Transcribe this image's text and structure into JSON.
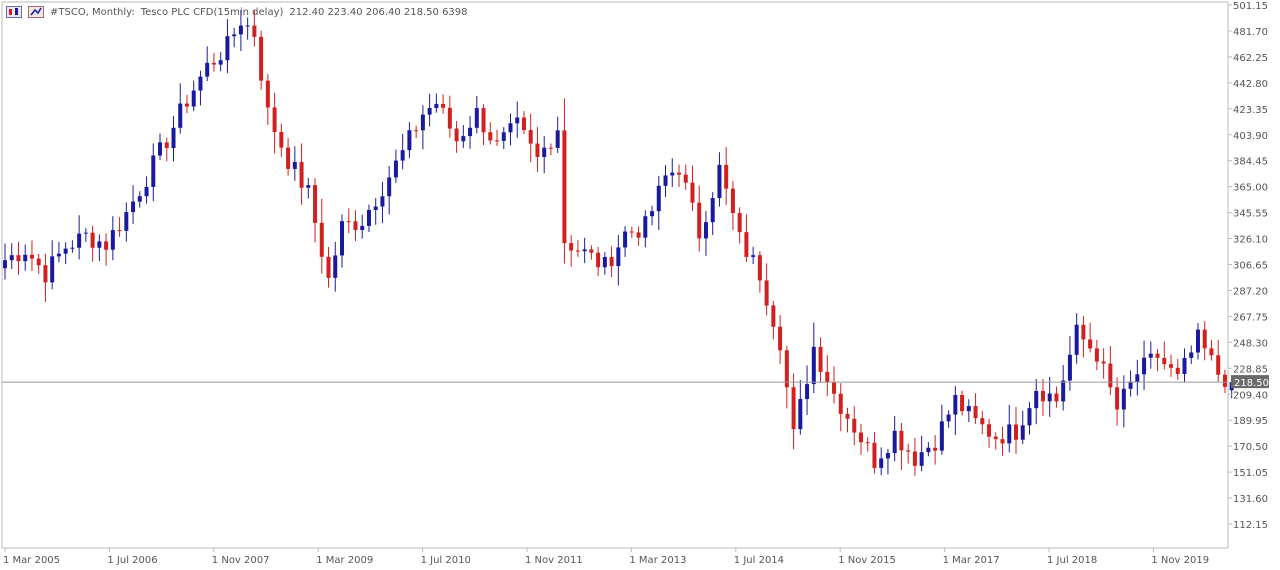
{
  "header": {
    "symbol": "#TSCO, Monthly:",
    "description": "Tesco PLC CFD(15min delay)",
    "ohlcv": "212.40 223.40 206.40 218.50  6398",
    "icons": [
      "chart-window-icon",
      "chart-settings-icon"
    ]
  },
  "colors": {
    "bull": "#1a1aa0",
    "bear": "#d21f1f",
    "axis_text": "#555555",
    "axis_line": "#bbbbbb",
    "price_line": "#999999",
    "price_label_bg": "#6a6a6a",
    "price_label_text": "#ffffff"
  },
  "chart_data": {
    "type": "candlestick",
    "title": "#TSCO, Monthly: Tesco PLC CFD(15min delay)",
    "ylim": [
      101.5,
      501.15
    ],
    "y_ticks": [
      "501.15",
      "481.70",
      "462.25",
      "442.80",
      "423.35",
      "403.90",
      "384.45",
      "365.00",
      "345.55",
      "326.10",
      "306.65",
      "287.20",
      "267.75",
      "248.30",
      "228.85",
      "209.40",
      "189.95",
      "170.50",
      "151.05",
      "131.60",
      "112.15"
    ],
    "x_ticks": [
      "1 Mar 2005",
      "1 Jul 2006",
      "1 Nov 2007",
      "1 Mar 2009",
      "1 Jul 2010",
      "1 Nov 2011",
      "1 Mar 2013",
      "1 Jul 2014",
      "1 Nov 2015",
      "1 Mar 2017",
      "1 Jul 2018",
      "1 Nov 2019"
    ],
    "current_price": "218.50",
    "last_bar": {
      "open": 212.4,
      "high": 223.4,
      "low": 206.4,
      "close": 218.5,
      "volume": 6398
    },
    "grid": false,
    "anchors": [
      [
        "2005-03",
        310
      ],
      [
        "2005-06",
        318
      ],
      [
        "2005-09",
        300
      ],
      [
        "2005-12",
        320
      ],
      [
        "2006-03",
        328
      ],
      [
        "2006-06",
        322
      ],
      [
        "2006-09",
        345
      ],
      [
        "2006-12",
        372
      ],
      [
        "2007-03",
        400
      ],
      [
        "2007-06",
        430
      ],
      [
        "2007-09",
        455
      ],
      [
        "2007-12",
        470
      ],
      [
        "2008-02",
        490
      ],
      [
        "2008-04",
        480
      ],
      [
        "2008-06",
        420
      ],
      [
        "2008-09",
        385
      ],
      [
        "2008-12",
        360
      ],
      [
        "2009-03",
        295
      ],
      [
        "2009-05",
        335
      ],
      [
        "2009-08",
        340
      ],
      [
        "2009-11",
        365
      ],
      [
        "2010-02",
        390
      ],
      [
        "2010-05",
        420
      ],
      [
        "2010-07",
        428
      ],
      [
        "2010-10",
        400
      ],
      [
        "2011-01",
        420
      ],
      [
        "2011-04",
        395
      ],
      [
        "2011-07",
        410
      ],
      [
        "2011-10",
        385
      ],
      [
        "2012-01",
        410
      ],
      [
        "2012-02",
        325
      ],
      [
        "2012-05",
        315
      ],
      [
        "2012-08",
        305
      ],
      [
        "2012-11",
        330
      ],
      [
        "2013-02",
        335
      ],
      [
        "2013-05",
        372
      ],
      [
        "2013-07",
        380
      ],
      [
        "2013-10",
        330
      ],
      [
        "2014-01",
        378
      ],
      [
        "2014-04",
        325
      ],
      [
        "2014-07",
        300
      ],
      [
        "2014-10",
        250
      ],
      [
        "2014-12",
        178
      ],
      [
        "2015-03",
        245
      ],
      [
        "2015-06",
        210
      ],
      [
        "2015-09",
        185
      ],
      [
        "2015-12",
        160
      ],
      [
        "2016-03",
        180
      ],
      [
        "2016-06",
        162
      ],
      [
        "2016-09",
        175
      ],
      [
        "2016-12",
        205
      ],
      [
        "2017-03",
        188
      ],
      [
        "2017-06",
        178
      ],
      [
        "2017-09",
        182
      ],
      [
        "2017-12",
        215
      ],
      [
        "2018-03",
        205
      ],
      [
        "2018-06",
        255
      ],
      [
        "2018-09",
        240
      ],
      [
        "2018-12",
        198
      ],
      [
        "2019-03",
        225
      ],
      [
        "2019-06",
        238
      ],
      [
        "2019-09",
        220
      ],
      [
        "2019-12",
        250
      ],
      [
        "2020-03",
        225
      ],
      [
        "2020-05",
        218.5
      ]
    ]
  }
}
